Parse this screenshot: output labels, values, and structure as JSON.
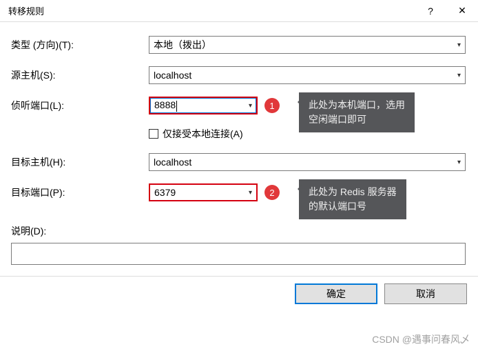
{
  "dialog": {
    "title": "转移规则",
    "help_icon": "?",
    "close_icon": "✕"
  },
  "fields": {
    "type": {
      "label": "类型 (方向)(T):",
      "value": "本地（拨出）"
    },
    "source_host": {
      "label": "源主机(S):",
      "value": "localhost"
    },
    "listen_port": {
      "label": "侦听端口(L):",
      "value": "8888"
    },
    "local_only": {
      "label": "仅接受本地连接(A)",
      "checked": false
    },
    "dest_host": {
      "label": "目标主机(H):",
      "value": "localhost"
    },
    "dest_port": {
      "label": "目标端口(P):",
      "value": "6379"
    },
    "description": {
      "label": "说明(D):",
      "value": ""
    }
  },
  "annotations": {
    "badge1": "1",
    "tip1": "此处为本机端口，选用\n空闲端口即可",
    "badge2": "2",
    "tip2": "此处为 Redis 服务器\n的默认端口号"
  },
  "buttons": {
    "ok": "确定",
    "cancel": "取消"
  },
  "watermark": "CSDN @遇事问春风乄"
}
